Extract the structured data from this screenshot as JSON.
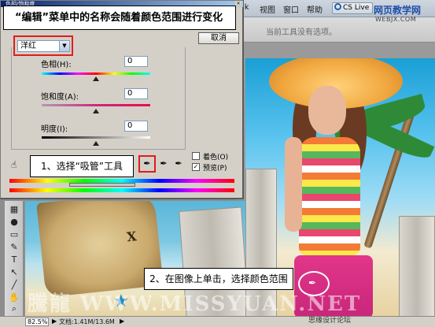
{
  "app": {
    "menu": [
      "lk",
      "视图",
      "窗口",
      "帮助"
    ],
    "cs_live": "CS Live",
    "options_text": "当前工具没有选项。"
  },
  "dialog": {
    "title": "色相/饱和度",
    "cancel_label": "取消",
    "edit_value": "洋红",
    "sliders": [
      {
        "label": "色相(H):",
        "value": "0"
      },
      {
        "label": "饱和度(A):",
        "value": "0"
      },
      {
        "label": "明度(I):",
        "value": "0"
      }
    ],
    "colorize_label": "着色(O)",
    "preview_label": "预览(P)",
    "preview_checked": true
  },
  "annotations": {
    "banner1": "“编辑”菜单中的名称会随着颜色范围进行变化",
    "banner2": "1、选择“吸管”工具",
    "banner3": "2、在图像上单击，选择颜色范围"
  },
  "status": {
    "zoom": "82.5%",
    "doc_size": "文档:1.41M/13.6M"
  },
  "watermark": {
    "site_cn": "网页教学网",
    "site_en": "WEBJX.COM",
    "bottom_logo": "騰龍 WWW.MISSYUAN.NET",
    "bottom_forum": "思缘设计论坛"
  },
  "colors": {
    "highlight_red": "#e11c1c",
    "title_blue": "#0a246a"
  }
}
